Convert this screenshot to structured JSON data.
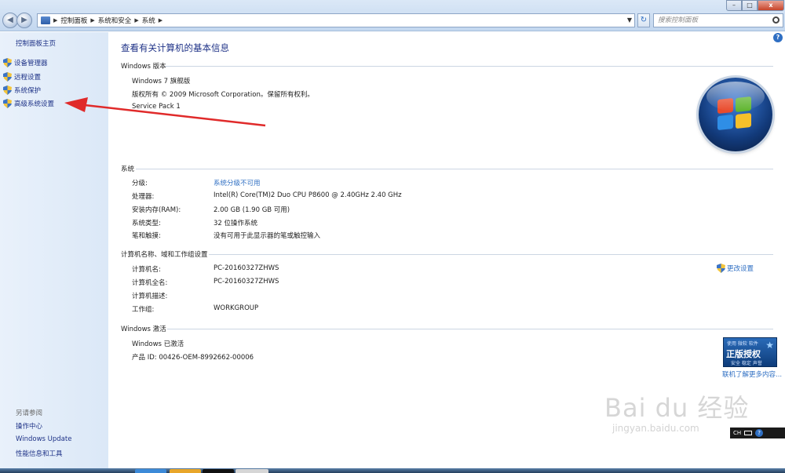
{
  "address_bar": {
    "crumbs": [
      "控制面板",
      "系统和安全",
      "系统"
    ],
    "search_placeholder": "搜索控制面板"
  },
  "window_controls": {
    "min": "–",
    "max": "□",
    "close": "x"
  },
  "sidebar": {
    "home_link": "控制面板主页",
    "tasks": [
      {
        "label": "设备管理器",
        "icon": "shield-icon"
      },
      {
        "label": "远程设置",
        "icon": "shield-icon"
      },
      {
        "label": "系统保护",
        "icon": "shield-icon"
      },
      {
        "label": "高级系统设置",
        "icon": "shield-icon"
      }
    ],
    "see_also_header": "另请参阅",
    "see_also": [
      "操作中心",
      "Windows Update",
      "性能信息和工具"
    ]
  },
  "main": {
    "title": "查看有关计算机的基本信息",
    "edition": {
      "header": "Windows 版本",
      "name": "Windows 7 旗舰版",
      "copyright": "版权所有 © 2009 Microsoft Corporation。保留所有权利。",
      "service_pack": "Service Pack 1"
    },
    "system": {
      "header": "系统",
      "rows": [
        {
          "label": "分级:",
          "value": "系统分级不可用",
          "link": true
        },
        {
          "label": "处理器:",
          "value": "Intel(R) Core(TM)2 Duo CPU     P8600  @ 2.40GHz   2.40 GHz",
          "link": false
        },
        {
          "label": "安装内存(RAM):",
          "value": "2.00 GB (1.90 GB 可用)",
          "link": false
        },
        {
          "label": "系统类型:",
          "value": "32 位操作系统",
          "link": false
        },
        {
          "label": "笔和触摸:",
          "value": "没有可用于此显示器的笔或触控输入",
          "link": false
        }
      ]
    },
    "computer": {
      "header": "计算机名称、域和工作组设置",
      "change_settings": "更改设置",
      "rows": [
        {
          "label": "计算机名:",
          "value": "PC-20160327ZHWS"
        },
        {
          "label": "计算机全名:",
          "value": "PC-20160327ZHWS"
        },
        {
          "label": "计算机描述:",
          "value": ""
        },
        {
          "label": "工作组:",
          "value": "WORKGROUP"
        }
      ]
    },
    "activation": {
      "header": "Windows 激活",
      "status": "Windows 已激活",
      "product_id": "产品 ID: 00426-OEM-8992662-00006",
      "badge_top": "使用 微软 软件",
      "badge_main": "正版授权",
      "badge_sub": "安全 稳定 声誉",
      "learn_more": "联机了解更多内容..."
    }
  },
  "tray": {
    "lang": "CH"
  },
  "watermark": {
    "main": "Bai du 经验",
    "sub": "jingyan.baidu.com"
  },
  "colors": {
    "link": "#2f6fc3",
    "heading": "#1e3287",
    "annotation_arrow": "#e02a2a"
  }
}
